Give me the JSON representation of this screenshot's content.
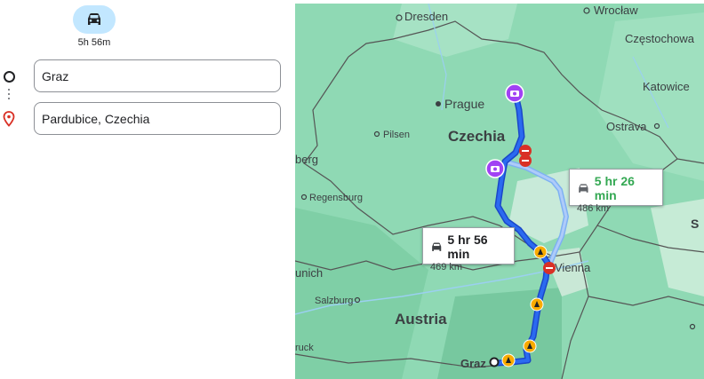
{
  "travel_mode": {
    "icon": "car-icon",
    "duration": "5h 56m",
    "color": "#c2e7ff"
  },
  "directions": {
    "origin_value": "Graz",
    "destination_value": "Pardubice, Czechia"
  },
  "map": {
    "labels": {
      "dresden": "Dresden",
      "wroclaw": "Wrocław",
      "czestochowa": "Częstochowa",
      "prague": "Prague",
      "katowice": "Katowice",
      "czechia": "Czechia",
      "pilsen": "Pilsen",
      "ostrava": "Ostrava",
      "berg": "berg",
      "regensburg": "Regensburg",
      "vienna": "Vienna",
      "s": "S",
      "unich": "unich",
      "salzburg": "Salzburg",
      "austria": "Austria",
      "ruck": "ruck",
      "graz": "Graz"
    },
    "routes": [
      {
        "time": "5 hr 56 min",
        "distance": "469 km",
        "selected": true,
        "color": "#1a73e8"
      },
      {
        "time": "5 hr 26 min",
        "distance": "486 km",
        "selected": false,
        "color": "#188038"
      }
    ]
  }
}
